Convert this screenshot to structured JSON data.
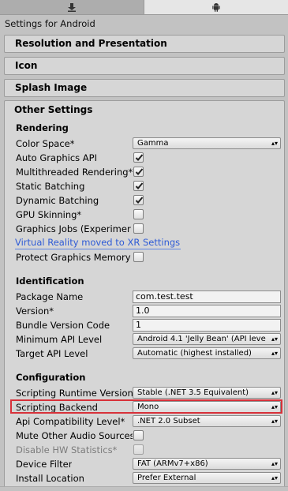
{
  "window_title": "Settings for Android",
  "foldouts": {
    "resolution": "Resolution and Presentation",
    "icon": "Icon",
    "splash": "Splash Image",
    "other": "Other Settings"
  },
  "rendering": {
    "heading": "Rendering",
    "color_space": {
      "label": "Color Space*",
      "value": "Gamma"
    },
    "auto_graphics_api": {
      "label": "Auto Graphics API",
      "checked": true
    },
    "multithreaded_rendering": {
      "label": "Multithreaded Rendering*",
      "checked": true
    },
    "static_batching": {
      "label": "Static Batching",
      "checked": true
    },
    "dynamic_batching": {
      "label": "Dynamic Batching",
      "checked": true
    },
    "gpu_skinning": {
      "label": "GPU Skinning*",
      "checked": false
    },
    "graphics_jobs": {
      "label": "Graphics Jobs (Experimer",
      "checked": false
    },
    "xr_link": "Virtual Reality moved to XR Settings",
    "protect_graphics_memory": {
      "label": "Protect Graphics Memory",
      "checked": false
    }
  },
  "identification": {
    "heading": "Identification",
    "package_name": {
      "label": "Package Name",
      "value": "com.test.test"
    },
    "version": {
      "label": "Version*",
      "value": "1.0"
    },
    "bundle_version_code": {
      "label": "Bundle Version Code",
      "value": "1"
    },
    "min_api_level": {
      "label": "Minimum API Level",
      "value": "Android 4.1 'Jelly Bean' (API leve"
    },
    "target_api_level": {
      "label": "Target API Level",
      "value": "Automatic (highest installed)"
    }
  },
  "configuration": {
    "heading": "Configuration",
    "scripting_runtime": {
      "label": "Scripting Runtime Version",
      "value": "Stable (.NET 3.5 Equivalent)"
    },
    "scripting_backend": {
      "label": "Scripting Backend",
      "value": "Mono"
    },
    "api_compat": {
      "label": "Api Compatibility Level*",
      "value": ".NET 2.0 Subset"
    },
    "mute_other_audio": {
      "label": "Mute Other Audio Sources",
      "checked": false
    },
    "disable_hw_stats": {
      "label": "Disable HW Statistics*",
      "checked": false
    },
    "device_filter": {
      "label": "Device Filter",
      "value": "FAT (ARMv7+x86)"
    },
    "install_location": {
      "label": "Install Location",
      "value": "Prefer External"
    }
  },
  "icons": {
    "standalone_tab": "download-icon",
    "android_tab": "android-icon",
    "dropdown_arrow": "updown-arrow-icon",
    "checkbox_mark": "checkmark-icon"
  },
  "colors": {
    "highlight": "#d8313a",
    "link": "#2e5bd6",
    "panel": "#d6d6d6"
  }
}
